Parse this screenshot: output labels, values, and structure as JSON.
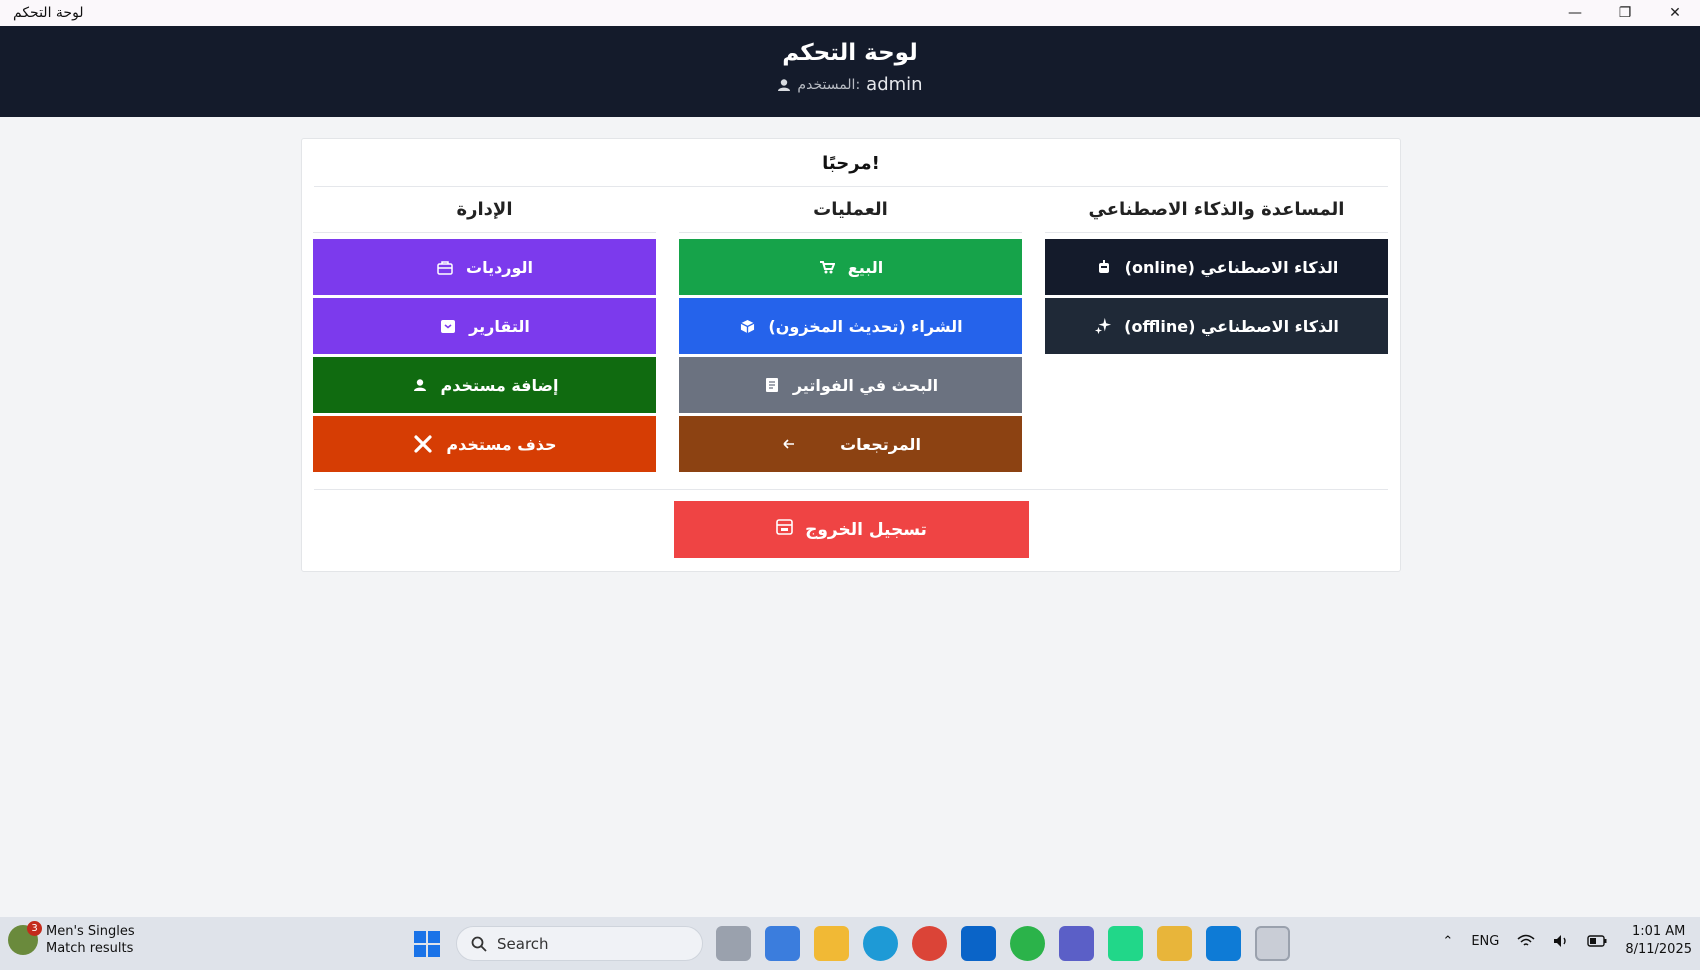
{
  "window": {
    "title": "لوحة التحكم",
    "minimize": "—",
    "maximize": "❐",
    "close": "✕"
  },
  "header": {
    "title": "لوحة التحكم",
    "user_label": "المستخدم:",
    "username": "admin"
  },
  "welcome": "!مرحبًا",
  "columns": {
    "admin": {
      "title": "الإدارة",
      "buttons": [
        {
          "label": "الورديات",
          "color": "#7c3aed",
          "icon": "briefcase-icon"
        },
        {
          "label": "التقارير",
          "color": "#7c3aed",
          "icon": "archive-icon"
        },
        {
          "label": "إضافة مستخدم",
          "color": "#106b10",
          "icon": "user-icon"
        },
        {
          "label": "حذف مستخدم",
          "color": "#d63d04",
          "icon": "close-icon"
        }
      ]
    },
    "ops": {
      "title": "العمليات",
      "buttons": [
        {
          "label": "البيع",
          "color": "#16a34a",
          "icon": "cart-icon"
        },
        {
          "label": "الشراء (تحديث المخزون)",
          "color": "#2563eb",
          "icon": "box-icon"
        },
        {
          "label": "البحث في الفواتير",
          "color": "#6b7280",
          "icon": "ledger-icon"
        },
        {
          "label": "المرتجعات",
          "color": "#8c4212",
          "icon": "return-icon"
        }
      ]
    },
    "ai": {
      "title": "المساعدة والذكاء الاصطناعي",
      "buttons": [
        {
          "label": "الذكاء الاصطناعي (online)",
          "color": "#141b2b",
          "icon": "robot-icon"
        },
        {
          "label": "الذكاء الاصطناعي (offline)",
          "color": "#1f2937",
          "icon": "sparkle-icon"
        }
      ]
    }
  },
  "logout": {
    "label": "تسجيل الخروج",
    "color": "#ef4444",
    "icon": "logout-icon"
  },
  "taskbar": {
    "weather_badge": "3",
    "weather_line1": "Men's Singles",
    "weather_line2": "Match results",
    "search_placeholder": "Search",
    "lang": "ENG",
    "time": "1:01 AM",
    "date": "8/11/2025"
  }
}
